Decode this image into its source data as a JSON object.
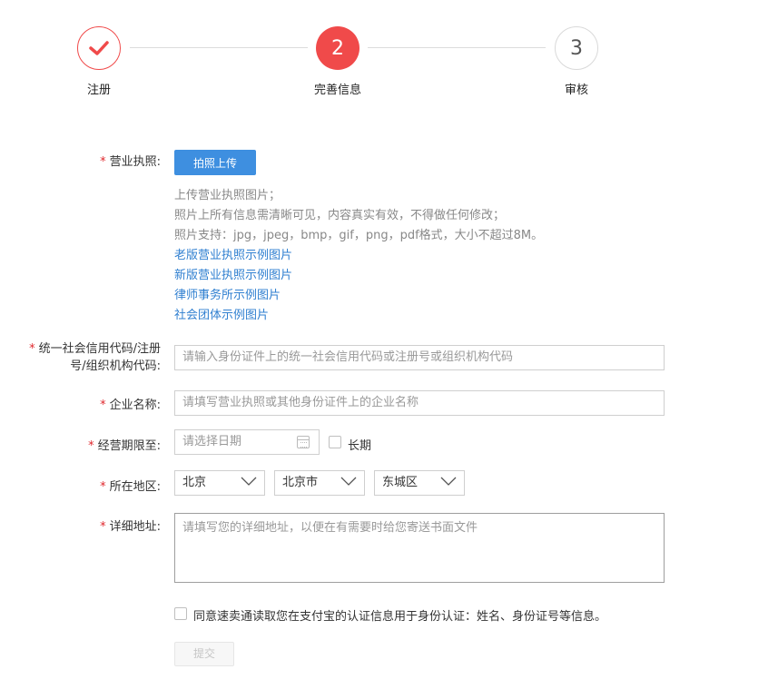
{
  "stepper": {
    "steps": [
      {
        "label": "注册",
        "number": "",
        "state": "done"
      },
      {
        "label": "完善信息",
        "number": "2",
        "state": "active"
      },
      {
        "label": "审核",
        "number": "3",
        "state": "todo"
      }
    ],
    "accent_color": "#f04a4a"
  },
  "license": {
    "label": "营业执照:",
    "upload_button": "拍照上传",
    "hints": [
      "上传营业执照图片；",
      "照片上所有信息需清晰可见，内容真实有效，不得做任何修改；",
      "照片支持：jpg，jpeg，bmp，gif，png，pdf格式，大小不超过8M。"
    ],
    "links": [
      "老版营业执照示例图片",
      "新版营业执照示例图片",
      "律师事务所示例图片",
      "社会团体示例图片"
    ]
  },
  "credit_code": {
    "label_line1": "统一社会信用代码/注册",
    "label_line2": "号/组织机构代码:",
    "placeholder": "请输入身份证件上的统一社会信用代码或注册号或组织机构代码"
  },
  "company_name": {
    "label": "企业名称:",
    "placeholder": "请填写营业执照或其他身份证件上的企业名称"
  },
  "period": {
    "label": "经营期限至:",
    "placeholder": "请选择日期",
    "long_term_label": "长期"
  },
  "region": {
    "label": "所在地区:",
    "province": "北京",
    "city": "北京市",
    "district": "东城区"
  },
  "address": {
    "label": "详细地址:",
    "placeholder": "请填写您的详细地址，以便在有需要时给您寄送书面文件"
  },
  "agreement": {
    "text": "同意速卖通读取您在支付宝的认证信息用于身份认证：姓名、身份证号等信息。"
  },
  "submit_label": "提交",
  "required_mark": "*"
}
